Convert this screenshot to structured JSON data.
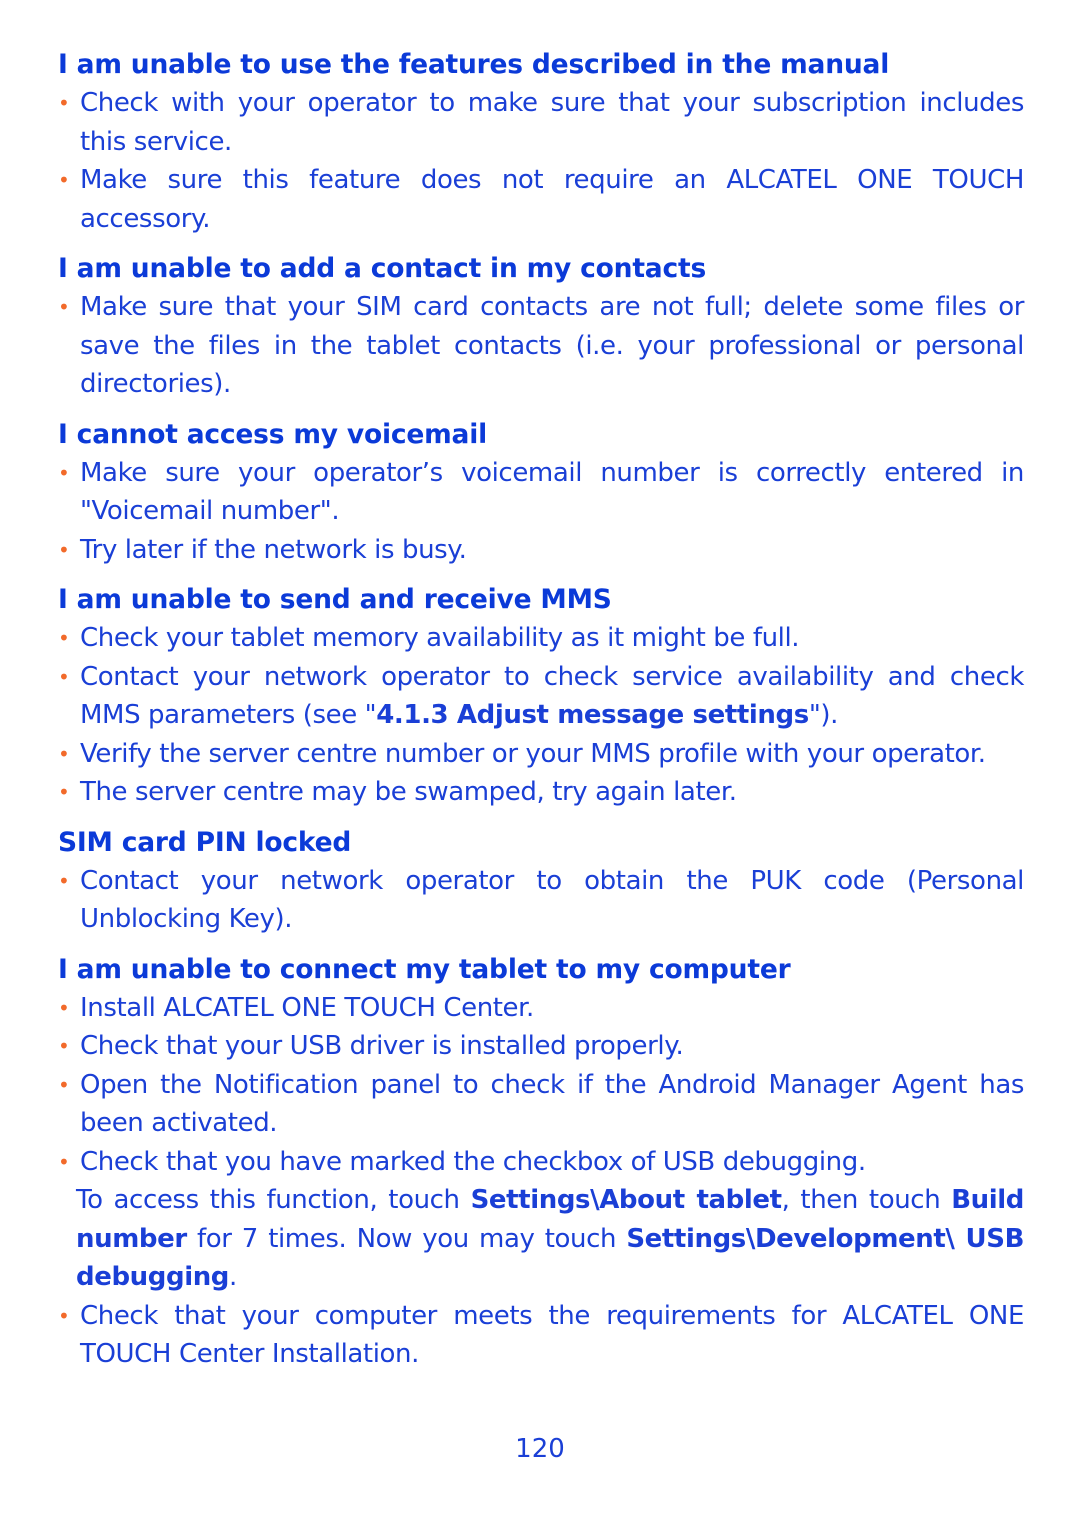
{
  "sections": [
    {
      "heading": "I am unable to use the features described in the manual",
      "bullets": [
        "Check with your operator to make sure that your subscription includes this service.",
        "Make sure this feature does not require an ALCATEL ONE TOUCH accessory."
      ]
    },
    {
      "heading": "I am unable to add a contact in my contacts",
      "bullets": [
        "Make sure that your SIM card contacts are not full; delete some files or save the files in the tablet contacts (i.e. your professional or personal directories)."
      ]
    },
    {
      "heading": "I cannot access my voicemail",
      "bullets": [
        "Make sure your operator’s voicemail number is correctly entered in \"Voicemail number\".",
        "Try later if the network is busy."
      ]
    },
    {
      "heading": "I am unable to send and receive MMS",
      "bullets": [
        "Check your tablet memory availability as it might be full.",
        "Contact your network operator to check service availability and check MMS parameters (see \"",
        "Verify the server centre number or your MMS profile with your operator.",
        "The server centre may be swamped, try again later."
      ],
      "mms_ref_bold": "4.1.3 Adjust message settings",
      "mms_ref_tail": "\")."
    },
    {
      "heading": "SIM card PIN locked",
      "bullets": [
        "Contact your network operator to obtain the PUK code (Personal Unblocking Key)."
      ]
    },
    {
      "heading": "I am unable to connect my tablet to my computer",
      "bullets": [
        "Install ALCATEL ONE TOUCH Center.",
        "Check that your USB driver is installed properly.",
        "Open the Notification panel to check if the Android Manager Agent has been activated.",
        "Check that you have marked the checkbox of USB debugging.",
        "Check that your computer meets the requirements for ALCATEL ONE TOUCH Center Installation."
      ],
      "note": {
        "t1": "To access this function, touch ",
        "b1": "Settings\\About tablet",
        "t2": ", then touch ",
        "b2": "Build number",
        "t3": " for 7 times. Now you may touch ",
        "b3": "Settings\\Development\\ USB debugging",
        "t4": "."
      }
    }
  ],
  "bullet_glyph": "•",
  "page_number": "120",
  "colors": {
    "text": "#1a3fd6",
    "bullet": "#f26a2a"
  }
}
